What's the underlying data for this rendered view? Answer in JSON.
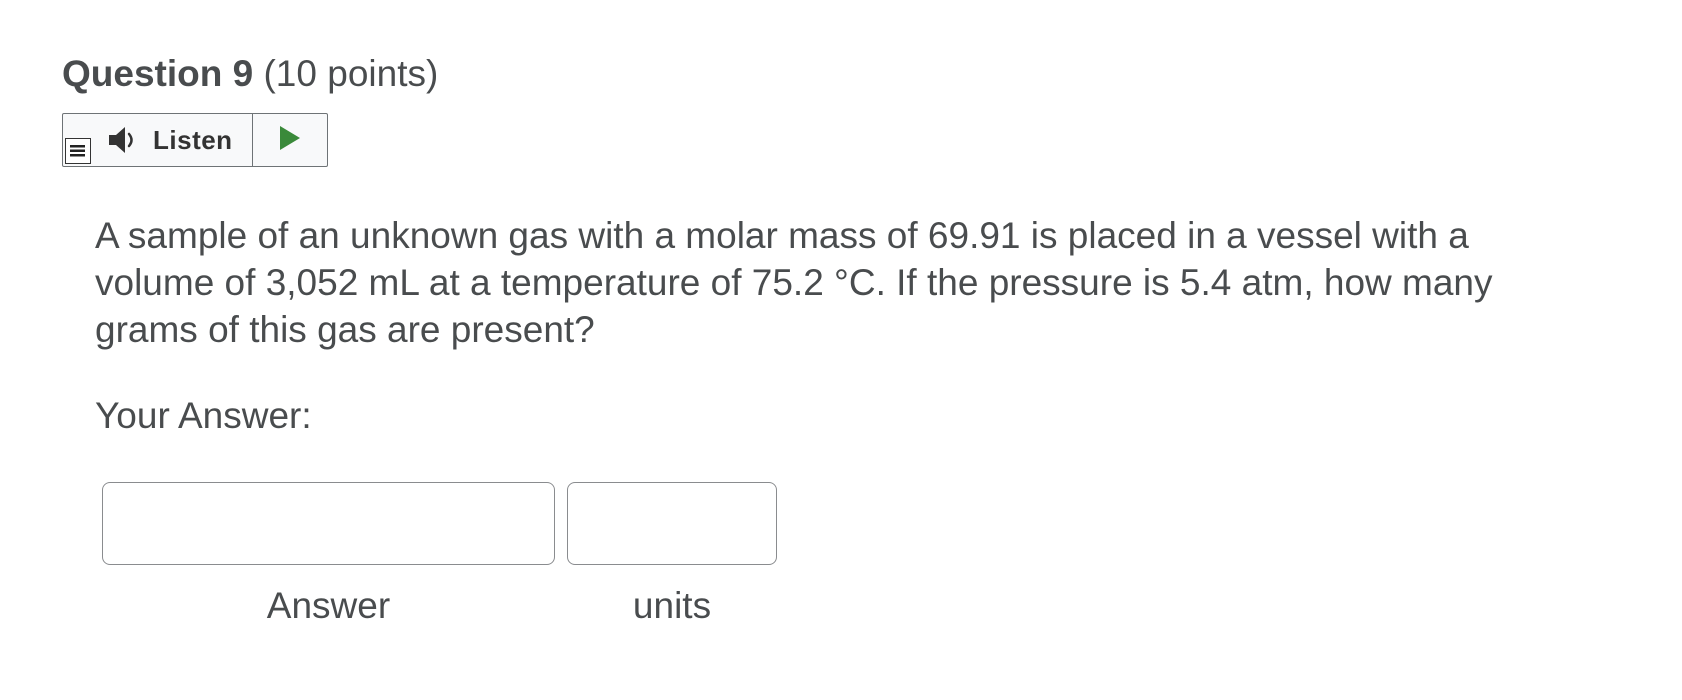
{
  "question": {
    "title": "Question 9",
    "points": "(10 points)",
    "text": "A sample of an unknown gas with a molar mass of 69.91 is placed in a vessel with a volume of 3,052 mL at a temperature of 75.2 °C. If the pressure is 5.4 atm, how many grams of this gas are present?"
  },
  "listen_toolbar": {
    "listen_label": "Listen",
    "menu_icon": "menu-icon",
    "speaker_icon": "speaker-icon",
    "play_icon": "play-icon",
    "play_color": "#3a8a3a"
  },
  "answer_section": {
    "prompt": "Your Answer:",
    "answer_value": "",
    "answer_caption": "Answer",
    "units_value": "",
    "units_caption": "units"
  }
}
